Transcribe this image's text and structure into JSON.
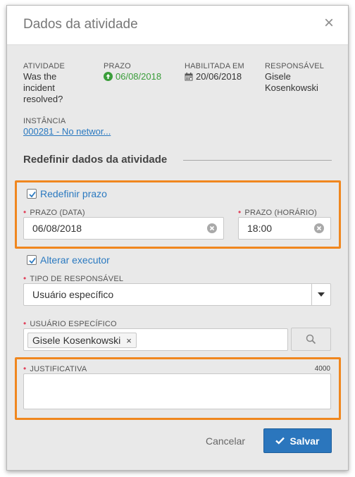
{
  "dialog": {
    "title": "Dados da atividade",
    "close_label": "×"
  },
  "info": {
    "atividade": {
      "label": "ATIVIDADE",
      "value_lines": [
        "Was the",
        "incident",
        "resolved?"
      ]
    },
    "prazo": {
      "label": "PRAZO",
      "value": "06/08/2018"
    },
    "habilitada": {
      "label": "HABILITADA EM",
      "value": "20/06/2018"
    },
    "responsavel": {
      "label": "RESPONSÁVEL",
      "value_lines": [
        "Gisele",
        "Kosenkowski"
      ]
    },
    "instancia": {
      "label": "INSTÂNCIA",
      "value": "000281 - No networ..."
    }
  },
  "section": {
    "title": "Redefinir dados da atividade"
  },
  "form": {
    "redefinir_prazo": {
      "label": "Redefinir prazo",
      "checked": true
    },
    "prazo_data": {
      "label": "PRAZO (DATA)",
      "value": "06/08/2018"
    },
    "prazo_horario": {
      "label": "PRAZO (HORÁRIO)",
      "value": "18:00"
    },
    "alterar_executor": {
      "label": "Alterar executor",
      "checked": true
    },
    "tipo_responsavel": {
      "label": "TIPO DE RESPONSÁVEL",
      "value": "Usuário específico"
    },
    "usuario_especifico": {
      "label": "USUÁRIO ESPECÍFICO",
      "tag": "Gisele Kosenkowski",
      "tag_remove": "×"
    },
    "justificativa": {
      "label": "JUSTIFICATIVA",
      "value": "",
      "counter": "4000"
    }
  },
  "footer": {
    "cancel_label": "Cancelar",
    "save_label": "Salvar"
  },
  "colors": {
    "highlight": "#f0871f",
    "primary": "#2b76bd",
    "link": "#2a79c0",
    "required": "#e0435c",
    "success": "#3a9d3a"
  }
}
